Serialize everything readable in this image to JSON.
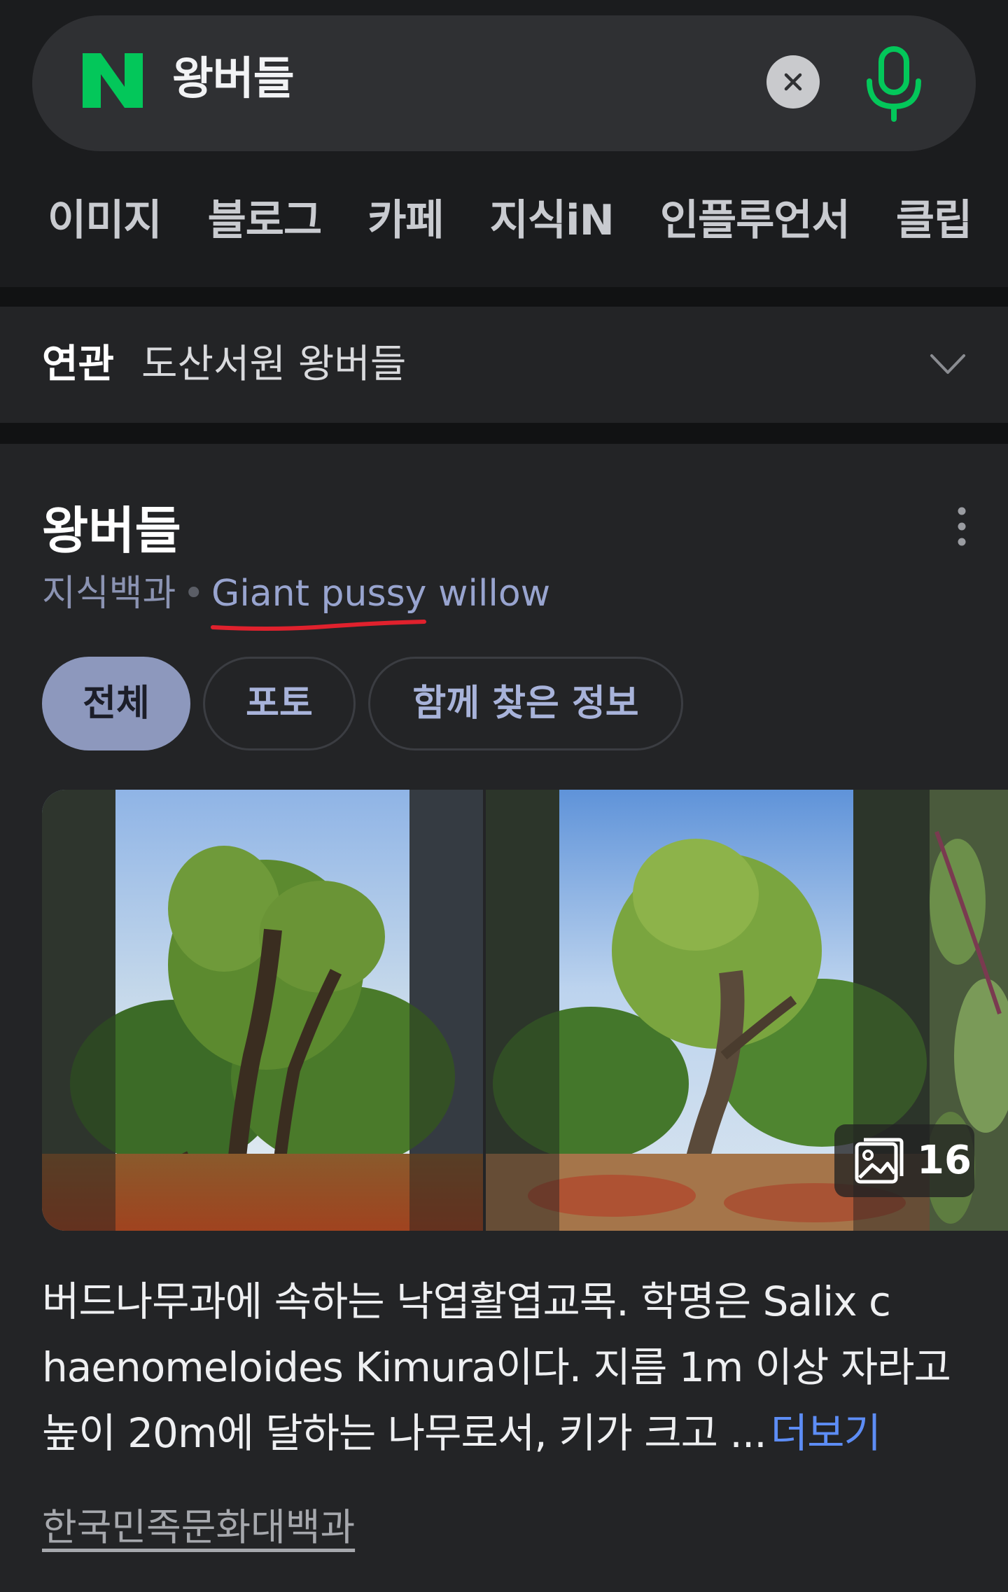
{
  "search": {
    "query": "왕버들",
    "logo_letter": "N",
    "colors": {
      "brand": "#03c75a",
      "bar": "#2f3033"
    }
  },
  "tabs": [
    {
      "label": "이미지"
    },
    {
      "label": "블로그"
    },
    {
      "label": "카페"
    },
    {
      "label": "지식iN"
    },
    {
      "label": "인플루언서"
    },
    {
      "label": "클립"
    }
  ],
  "related": {
    "label": "연관",
    "query": "도산서원 왕버들"
  },
  "card": {
    "title": "왕버들",
    "source_label": "지식백과",
    "english_name": "Giant pussy willow",
    "pills": [
      {
        "label": "전체",
        "active": true
      },
      {
        "label": "포토",
        "active": false
      },
      {
        "label": "함께 찾은 정보",
        "active": false
      }
    ],
    "photo_count": "16",
    "description": {
      "line1": "버드나무과에 속하는 낙엽활엽교목. 학명은 Salix c",
      "line2": "haenomeloides Kimura이다. 지름 1m 이상 자라고",
      "line3": "높이 20m에 달하는 나무로서, 키가 크고 ...",
      "more": "더보기"
    },
    "reference": "한국민족문화대백과"
  },
  "icons": {
    "logo": "naver-logo-icon",
    "clear": "close-icon",
    "mic": "microphone-icon",
    "chevron": "chevron-down-icon",
    "menu": "more-vertical-icon",
    "gallery": "image-icon"
  }
}
